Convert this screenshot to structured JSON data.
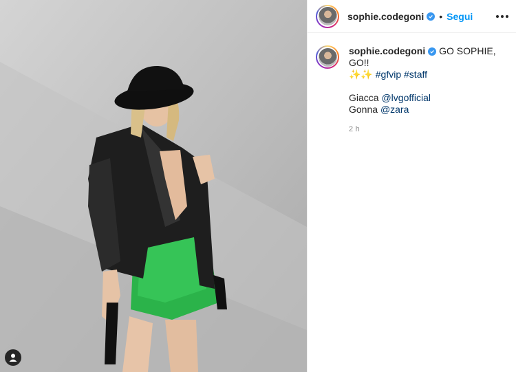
{
  "post": {
    "image_alt": "Woman in black hat, black leather jacket and green mini skirt",
    "tag_icon": "person-tag-icon"
  },
  "header": {
    "username": "sophie.codegoni",
    "separator": "•",
    "follow_label": "Segui",
    "more_icon": "more-options-icon"
  },
  "caption": {
    "username": "sophie.codegoni",
    "text_line1": " GO SOPHIE, GO!!",
    "emoji": "✨✨",
    "hashtag1": "#gfvip",
    "hashtag2": "#staff",
    "credit1_label": "Giacca ",
    "credit1_link": "@lvgofficial",
    "credit2_label": "Gonna ",
    "credit2_link": "@zara",
    "time": "2 h"
  },
  "colors": {
    "verified": "#3897f0",
    "follow": "#0095f6",
    "link": "#00376b"
  }
}
